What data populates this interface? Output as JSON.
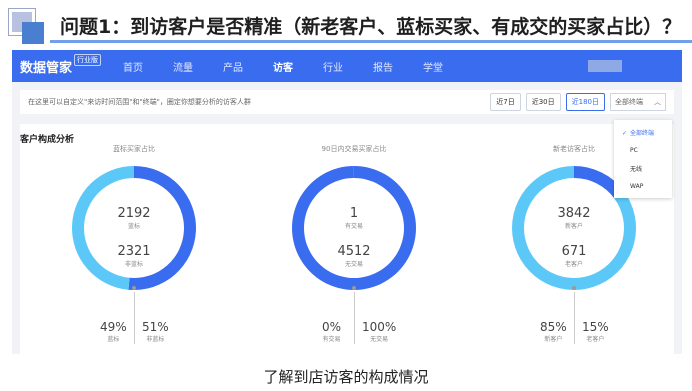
{
  "slide": {
    "title": "问题1：到访客户是否精准（新老客户、蓝标买家、有成交的买家占比）？",
    "caption": "了解到店访客的构成情况"
  },
  "app": {
    "brand": "数据管家",
    "brand_tag": "行业版",
    "nav": [
      "首页",
      "流量",
      "产品",
      "访客",
      "行业",
      "报告",
      "学堂"
    ],
    "nav_active": "访客"
  },
  "filter": {
    "hint": "在这里可以自定义\"来访时间范围\"和\"终端\"，圈定你想要分析的访客人群",
    "ranges": [
      "近7日",
      "近30日",
      "近180日"
    ],
    "active_range": "近180日",
    "terminal_value": "全部终端",
    "terminal_options": [
      "全部终端",
      "PC",
      "无线",
      "WAP"
    ]
  },
  "panel": {
    "title": "客户构成分析"
  },
  "colors": {
    "primary": "#3a6cf0",
    "secondary": "#5cc8f7",
    "nav": "#3a6cf0"
  },
  "chart_data": [
    {
      "type": "pie",
      "title": "蓝标买家占比",
      "categories": [
        "蓝标",
        "非蓝标"
      ],
      "values": [
        2192,
        2321
      ],
      "percents": [
        "49%",
        "51%"
      ],
      "counts": [
        "2192",
        "2321"
      ]
    },
    {
      "type": "pie",
      "title": "90日内交易买家占比",
      "categories": [
        "有交易",
        "无交易"
      ],
      "values": [
        1,
        4512
      ],
      "percents": [
        "0%",
        "100%"
      ],
      "counts": [
        "1",
        "4512"
      ]
    },
    {
      "type": "pie",
      "title": "新老访客占比",
      "categories": [
        "新客户",
        "老客户"
      ],
      "values": [
        3842,
        671
      ],
      "percents": [
        "85%",
        "15%"
      ],
      "counts": [
        "3842",
        "671"
      ]
    }
  ]
}
